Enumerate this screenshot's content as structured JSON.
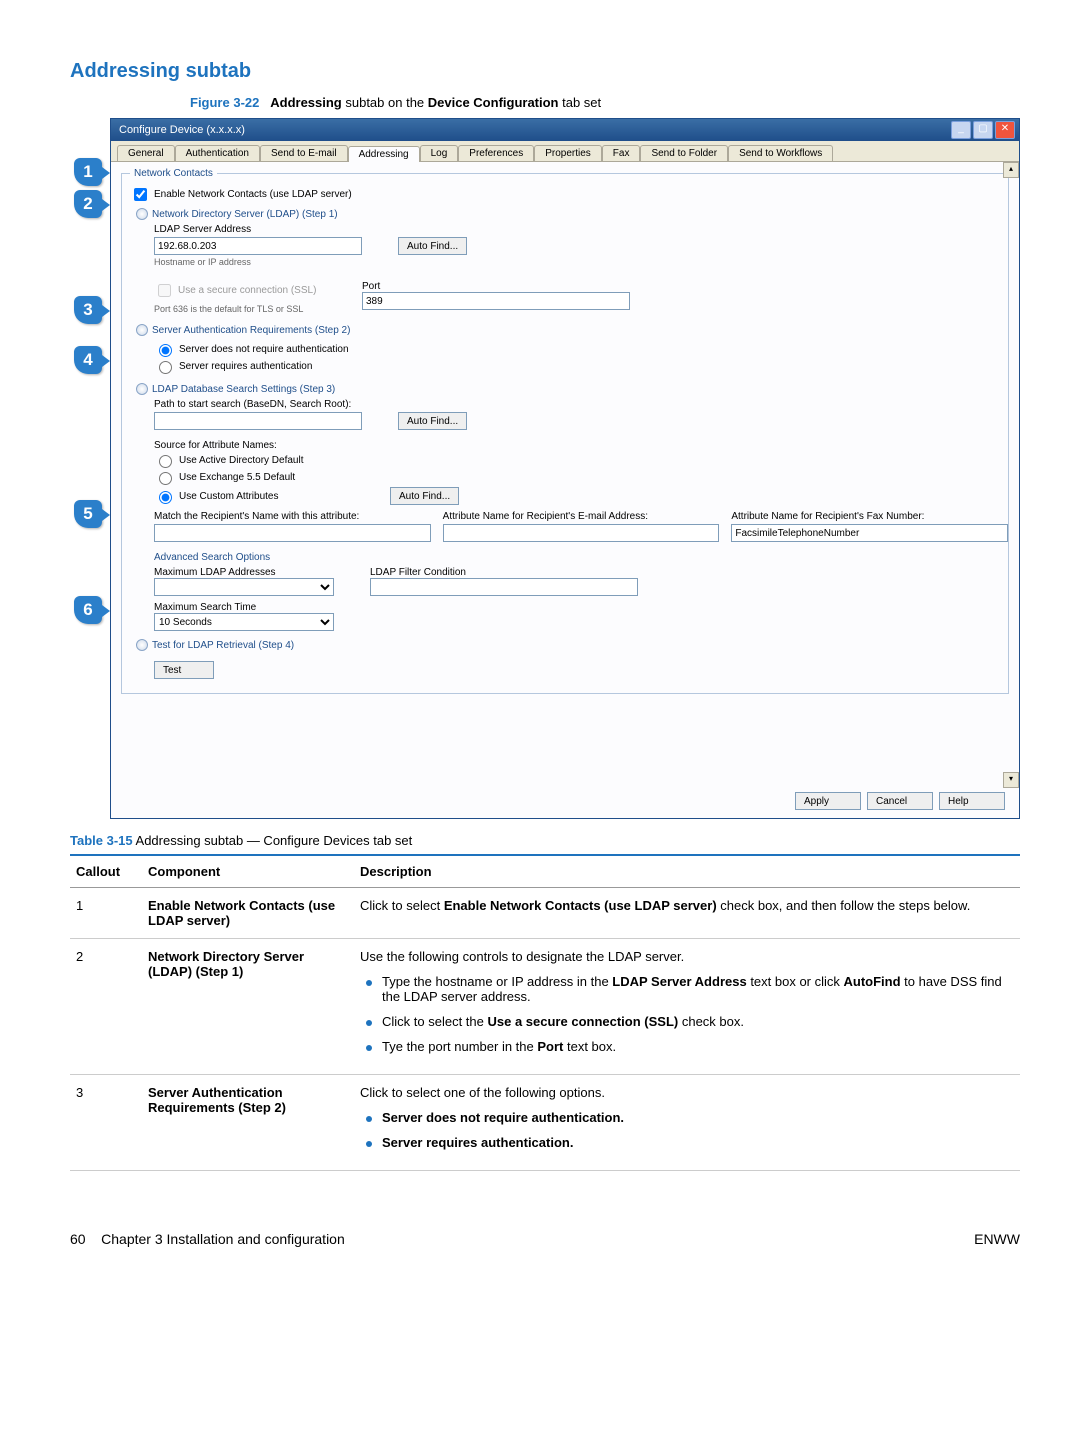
{
  "page": {
    "section_title": "Addressing subtab",
    "figure_id": "Figure 3-22",
    "figure_text_1": "Addressing",
    "figure_text_2": " subtab on the ",
    "figure_text_3": "Device Configuration",
    "figure_text_4": " tab set",
    "table_id": "Table 3-15",
    "table_title": " Addressing subtab — Configure Devices tab set",
    "footer_left_pageno": "60",
    "footer_left_chapter": "Chapter 3   Installation and configuration",
    "footer_right": "ENWW"
  },
  "callouts": [
    "1",
    "2",
    "3",
    "4",
    "5",
    "6"
  ],
  "window": {
    "title": "Configure Device (x.x.x.x)",
    "tabs": [
      "General",
      "Authentication",
      "Send to E-mail",
      "Addressing",
      "Log",
      "Preferences",
      "Properties",
      "Fax",
      "Send to Folder",
      "Send to Workflows"
    ],
    "active_tab_index": 3,
    "fieldset_legend": "Network Contacts",
    "enable_checkbox_label": "Enable Network Contacts (use LDAP server)",
    "enable_checkbox_checked": true,
    "step1": {
      "title": "Network Directory Server (LDAP) (Step 1)",
      "server_label": "LDAP Server Address",
      "server_value": "192.68.0.203",
      "server_hint": "Hostname or IP address",
      "autofind": "Auto Find...",
      "ssl_label": "Use a secure connection (SSL)",
      "ssl_checked": false,
      "port_label": "Port",
      "port_value": "389",
      "port_hint": "Port 636 is the default for TLS or SSL"
    },
    "step2": {
      "title": "Server Authentication Requirements (Step 2)",
      "opt1": "Server does not require authentication",
      "opt2": "Server requires authentication",
      "selected": 0
    },
    "step3": {
      "title": "LDAP Database Search Settings (Step 3)",
      "path_label": "Path to start search (BaseDN, Search Root):",
      "path_value": "",
      "autofind": "Auto Find...",
      "source_label": "Source for Attribute Names:",
      "src_opt1": "Use Active Directory Default",
      "src_opt2": "Use Exchange 5.5 Default",
      "src_opt3": "Use Custom Attributes",
      "src_selected": 2,
      "autofind2": "Auto Find...",
      "col1_label": "Match the Recipient's Name with this attribute:",
      "col1_value": "",
      "col2_label": "Attribute Name for Recipient's E-mail Address:",
      "col2_value": "",
      "col3_label": "Attribute Name for Recipient's Fax Number:",
      "col3_value": "FacsimileTelephoneNumber",
      "adv_title": "Advanced Search Options",
      "max_addr_label": "Maximum LDAP Addresses",
      "max_addr_value": "",
      "filter_label": "LDAP Filter Condition",
      "filter_value": "",
      "max_time_label": "Maximum Search Time",
      "max_time_value": "10 Seconds"
    },
    "step4": {
      "title": "Test for LDAP Retrieval (Step 4)",
      "test_btn": "Test"
    },
    "buttons": {
      "apply": "Apply",
      "cancel": "Cancel",
      "help": "Help"
    }
  },
  "table": {
    "headers": {
      "callout": "Callout",
      "component": "Component",
      "description": "Description"
    },
    "rows": [
      {
        "callout": "1",
        "component": "Enable Network Contacts (use LDAP server)",
        "desc_pre": "Click to select ",
        "desc_bold": "Enable Network Contacts (use LDAP server)",
        "desc_post": " check box, and then follow the steps below."
      },
      {
        "callout": "2",
        "component": "Network Directory Server (LDAP) (Step 1)",
        "desc_line": "Use the following controls to designate the LDAP server.",
        "b1_pre": "Type the hostname or IP address in the ",
        "b1_bold1": "LDAP Server Address",
        "b1_mid": " text box or click ",
        "b1_bold2": "AutoFind",
        "b1_post": " to have DSS find the LDAP server address.",
        "b2_pre": "Click to select the ",
        "b2_bold": "Use a secure connection (SSL)",
        "b2_post": " check box.",
        "b3_pre": "Tye the port number in the ",
        "b3_bold": "Port",
        "b3_post": " text box."
      },
      {
        "callout": "3",
        "component": "Server Authentication Requirements (Step 2)",
        "desc_line": "Click to select one of the following options.",
        "b1": "Server does not require authentication.",
        "b2": "Server requires authentication."
      }
    ]
  }
}
